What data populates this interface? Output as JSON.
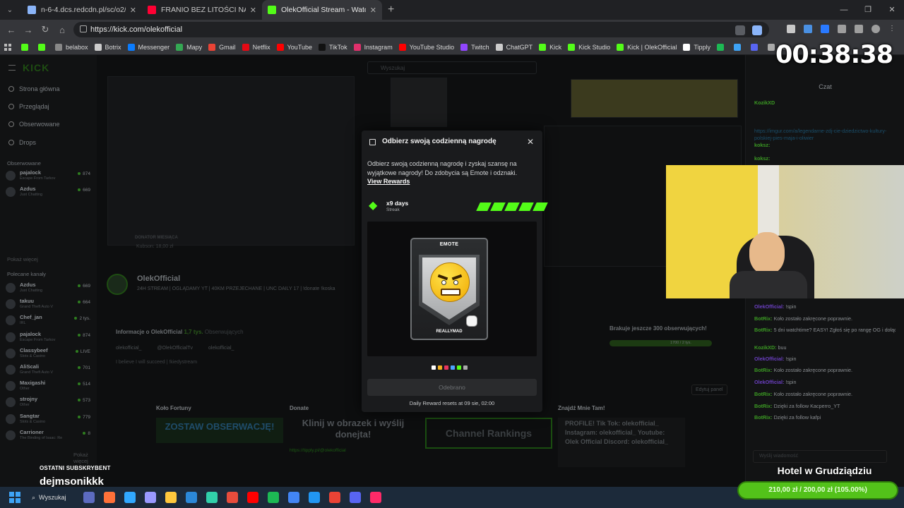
{
  "browser": {
    "tabs": [
      {
        "title": "n-6-4.dcs.redcdn.pl/sc/o2/Euro",
        "color": "#8ab4f8",
        "active": false
      },
      {
        "title": "FRANIO BEZ LITOŚCI NAD BAŁT",
        "color": "#ff0033",
        "active": false
      },
      {
        "title": "OlekOfficial Stream - Watch Liv",
        "color": "#53fc18",
        "active": true
      }
    ],
    "url": "https://kick.com/olekofficial",
    "bookmarks": [
      {
        "label": "",
        "color": "#53fc18"
      },
      {
        "label": "",
        "color": "#53fc18"
      },
      {
        "label": "belabox",
        "color": "#888888"
      },
      {
        "label": "Botrix",
        "color": "#cccccc"
      },
      {
        "label": "Messenger",
        "color": "#0a7cff"
      },
      {
        "label": "Mapy",
        "color": "#34a853"
      },
      {
        "label": "Gmail",
        "color": "#ea4335"
      },
      {
        "label": "Netflix",
        "color": "#e50914"
      },
      {
        "label": "YouTube",
        "color": "#ff0000"
      },
      {
        "label": "TikTok",
        "color": "#111111"
      },
      {
        "label": "Instagram",
        "color": "#e1306c"
      },
      {
        "label": "YouTube Studio",
        "color": "#ff0000"
      },
      {
        "label": "Twitch",
        "color": "#9146ff"
      },
      {
        "label": "ChatGPT",
        "color": "#cccccc"
      },
      {
        "label": "Kick",
        "color": "#53fc18"
      },
      {
        "label": "Kick Studio",
        "color": "#53fc18"
      },
      {
        "label": "Kick | OlekOfficial",
        "color": "#53fc18"
      },
      {
        "label": "Tipply",
        "color": "#ffffff"
      },
      {
        "label": "",
        "color": "#1db954"
      },
      {
        "label": "",
        "color": "#3ea3f5"
      },
      {
        "label": "",
        "color": "#5865f2"
      },
      {
        "label": "SE",
        "color": "#aaaaaa"
      }
    ]
  },
  "stream_overlay": {
    "timer": "00:38:38",
    "last_sub_label": "OSTATNI SUBSKRYBENT",
    "last_sub_name": "dejmsonikkk",
    "goal_title": "Hotel w Grudziądziu",
    "goal_current": "210,00 zł",
    "goal_sep": "/",
    "goal_target": "200,00 zł",
    "goal_pct": "(105.00%)"
  },
  "kick": {
    "search_placeholder": "Wyszukaj",
    "nav": [
      "Strona główna",
      "Przeglądaj",
      "Obserwowane",
      "Drops"
    ],
    "followed_header": "Obserwowane",
    "followed": [
      {
        "name": "pajalock",
        "game": "Escape From Tarkov",
        "viewers": "874"
      },
      {
        "name": "Azdus",
        "game": "Just Chatting",
        "viewers": "669"
      }
    ],
    "recommended_header": "Polecane kanały",
    "recommended": [
      {
        "name": "Azdus",
        "game": "Just Chatting",
        "viewers": "669"
      },
      {
        "name": "takuu",
        "game": "Grand Theft Auto V",
        "viewers": "664"
      },
      {
        "name": "Chef_jan",
        "game": "IRL",
        "viewers": "2 tys."
      },
      {
        "name": "pajalock",
        "game": "Escape From Tarkov",
        "viewers": "874"
      },
      {
        "name": "Classybeef",
        "game": "Slots & Casino",
        "viewers": "LIVE"
      },
      {
        "name": "AliScali",
        "game": "Grand Theft Auto V",
        "viewers": "701"
      },
      {
        "name": "Maxigashi",
        "game": "Other",
        "viewers": "514"
      },
      {
        "name": "strojny",
        "game": "Other",
        "viewers": "573"
      },
      {
        "name": "Sangtar",
        "game": "Slots & Casino",
        "viewers": "779"
      },
      {
        "name": "Carrioner",
        "game": "The Binding of Isaac: Re",
        "viewers": "8"
      }
    ],
    "show_more": "Pokaż więcej",
    "channel_name": "OlekOfficial",
    "channel_desc": "24H STREAM | OGLĄDAMY YT | 40KM PRZEJECHANE | UNC DAILY 17 | !donate !koska",
    "about_title": "Informacje o OlekOfficial",
    "followers": "1,7 tys.",
    "followers_label": "Obserwujących",
    "socials": [
      "olekofficial_",
      "@OlekOfficialTv",
      "olekofficial_"
    ],
    "about_text": "I believe I will succeed | !kiedystream",
    "followers_missing": "Brakuje jeszcze 300 obserwujących!",
    "followers_progress": "1700 / 2 tys.",
    "edit_panel": "Edytuj panel",
    "panels": [
      "Koło Fortuny",
      "Donate",
      "Znajdź Mnie Tam!"
    ],
    "panel_texts": [
      "ZOSTAW OBSERWACJĘ!",
      "Klinij w obrazek i wyślij donejta!",
      "Channel Rankings",
      "PROFILE! Tik Tok: olekofficial_ Instagram: olekofficial_ Youtube: Olek Official Discord: olekofficial_"
    ],
    "tipply_link": "https://tipply.pl/@olekofficial",
    "donator_label": "DONATOR MIESIĄCA",
    "donator_value": "Kubson: 18,00 zł"
  },
  "chat": {
    "title": "Czat",
    "pinned_user": "KozikXD",
    "pinned_link": "https://imgur.com/a/legendarne-zdj-cie-dziedzictwo-kultury-polskiej-pies-maja-i-oliwier",
    "messages": [
      {
        "user": "koksz",
        "text": ""
      },
      {
        "user": "koksz",
        "text": ""
      },
      {
        "user": "OlekOfficial",
        "text": "!spin"
      },
      {
        "user": "BotRix",
        "text": "Koło zostało zakręcone poprawnie."
      },
      {
        "user": "BotRix",
        "text": "5 dni watchtime? EASY! Zgłoś się po rangę OG i dołącz do legend czatu"
      },
      {
        "user": "KozikXD",
        "text": "buu"
      },
      {
        "user": "OlekOfficial",
        "text": "!spin"
      },
      {
        "user": "BotRix",
        "text": "Koło zostało zakręcone poprawnie."
      },
      {
        "user": "OlekOfficial",
        "text": "!spin"
      },
      {
        "user": "BotRix",
        "text": "Koło zostało zakręcone poprawnie."
      },
      {
        "user": "BotRix",
        "text": "Dzięki za follow Kacperro_YT"
      },
      {
        "user": "BotRix",
        "text": "Dzięki za follow kafpi"
      }
    ],
    "input_placeholder": "Wyślij wiadomość"
  },
  "modal": {
    "title": "Odbierz swoją codzienną nagrodę",
    "description": "Odbierz swoją codzienną nagrodę i zyskaj szansę na wyjątkowe nagrody! Do zdobycia są Emote i odznaki.",
    "link": "View Rewards",
    "streak_days": "x9 days",
    "streak_label": "Streak",
    "streak_bars": 5,
    "card_type": "EMOTE",
    "card_name": "REALLYMAD",
    "dots_colors": [
      "#ffffff",
      "#f2b01e",
      "#e8365d",
      "#4da3ff",
      "#53fc18",
      "#aaaaaa"
    ],
    "button_label": "Odebrano",
    "reset_text": "Daily Reward resets at 09 sie, 02:00",
    "accent": "#53fc18"
  },
  "taskbar": {
    "search": "Wyszukaj",
    "icons": [
      "#5c6bc0",
      "#ff7139",
      "#31a8ff",
      "#9999ff",
      "#ffc83d",
      "#2b88d8",
      "#31d0aa",
      "#e74c3c",
      "#ff0000",
      "#1db954",
      "#4285f4",
      "#2196f3",
      "#ea4335",
      "#5865f2",
      "#ff2a68"
    ]
  }
}
